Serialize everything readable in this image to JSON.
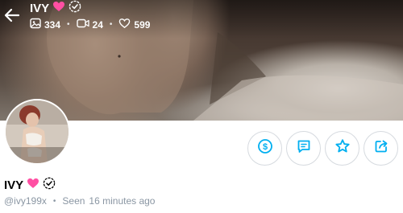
{
  "profile": {
    "name": "IVY",
    "handle": "@ivy199x",
    "last_seen_label": "Seen",
    "last_seen_time": "16 minutes ago"
  },
  "stats": {
    "photos": "334",
    "videos": "24",
    "likes": "599"
  },
  "actions": [
    {
      "name": "tip",
      "icon": "dollar-circle-icon"
    },
    {
      "name": "message",
      "icon": "chat-icon"
    },
    {
      "name": "favorite",
      "icon": "star-icon"
    },
    {
      "name": "share",
      "icon": "share-icon"
    }
  ],
  "colors": {
    "accent": "#00aff0",
    "heart": "#ff4fa3",
    "muted_text": "#8a96a3",
    "button_border": "#d6dadf"
  }
}
